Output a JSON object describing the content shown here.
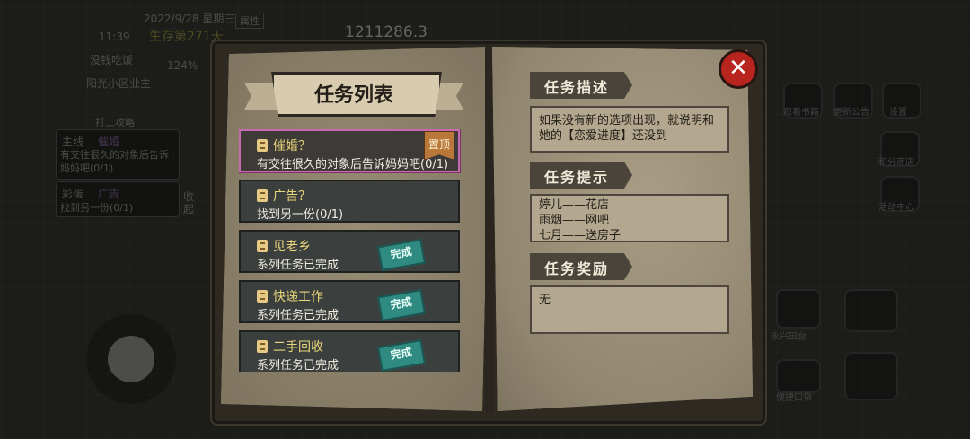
{
  "hud": {
    "date": "2022/9/28 星期三",
    "attr": "属性",
    "time": "11:39",
    "survive": "生存第271天",
    "money": "1211286.3",
    "percent": "124%",
    "resident": "阳光小区业主",
    "nickname": "没钱吃饭",
    "work_btn": "打工攻略",
    "collapse": "收起",
    "side_tasks": [
      {
        "type": "主线",
        "name": "催婚",
        "desc": "有交往很久的对象后告诉妈妈吧(0/1)"
      },
      {
        "type": "彩蛋",
        "name": "广告",
        "desc": "找到另一份(0/1)"
      }
    ],
    "right_icons": [
      "观看书籍",
      "更新公告",
      "设置",
      "积分商店",
      "活动中心",
      "永兴田台",
      "便捷口袋"
    ]
  },
  "panel": {
    "title": "任务列表",
    "pin_label": "置顶",
    "done_label": "完成",
    "tasks": [
      {
        "name": "催婚？",
        "desc": "有交往很久的对象后告诉妈妈吧(0/1)",
        "selected": true,
        "pinned": true,
        "done": false
      },
      {
        "name": "广告？",
        "desc": "找到另一份(0/1)",
        "selected": false,
        "pinned": false,
        "done": false
      },
      {
        "name": "见老乡",
        "desc": "系列任务已完成",
        "selected": false,
        "pinned": false,
        "done": true
      },
      {
        "name": "快递工作",
        "desc": "系列任务已完成",
        "selected": false,
        "pinned": false,
        "done": true
      },
      {
        "name": "二手回收",
        "desc": "系列任务已完成",
        "selected": false,
        "pinned": false,
        "done": true
      }
    ],
    "description_header": "任务描述",
    "description": "如果没有新的选项出现，就说明和她的【恋爱进度】还没到",
    "hint_header": "任务提示",
    "hints": [
      "婷儿——花店",
      "雨烟——网吧",
      "七月——送房子"
    ],
    "reward_header": "任务奖励",
    "reward": "无",
    "close_icon": "close-icon"
  }
}
